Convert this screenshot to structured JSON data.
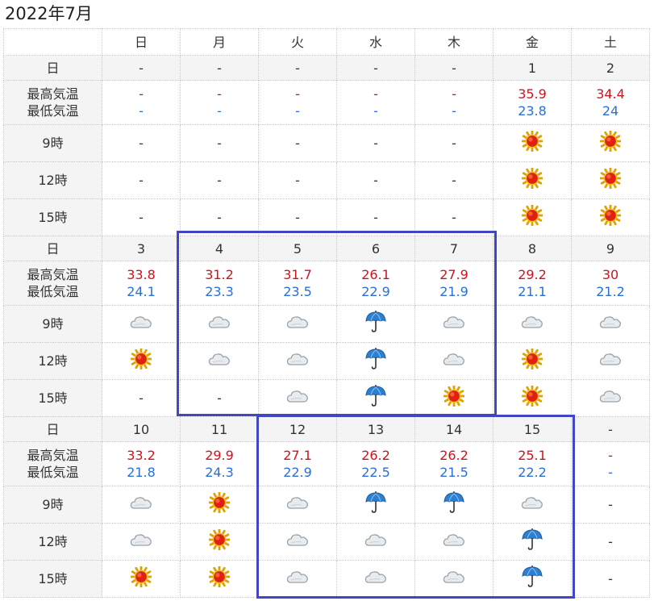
{
  "title": "2022年7月",
  "weekdays": [
    "日",
    "月",
    "火",
    "水",
    "木",
    "金",
    "土"
  ],
  "labels": {
    "date": "日",
    "high": "最高気温",
    "low": "最低気温",
    "h9": "9時",
    "h12": "12時",
    "h15": "15時"
  },
  "colors": {
    "sunday": "#d0121b",
    "saturday": "#2a6fd6",
    "high": "#d0121b",
    "low": "#2a6fd6",
    "highlight": "#4046c4"
  },
  "weeks": [
    {
      "days": [
        {
          "date": "-",
          "high": "-",
          "low": "-",
          "h9": "-",
          "h12": "-",
          "h15": "-"
        },
        {
          "date": "-",
          "high": "-",
          "low": "-",
          "h9": "-",
          "h12": "-",
          "h15": "-"
        },
        {
          "date": "-",
          "high": "-",
          "low": "-",
          "h9": "-",
          "h12": "-",
          "h15": "-"
        },
        {
          "date": "-",
          "high": "-",
          "low": "-",
          "h9": "-",
          "h12": "-",
          "h15": "-"
        },
        {
          "date": "-",
          "high": "-",
          "low": "-",
          "h9": "-",
          "h12": "-",
          "h15": "-"
        },
        {
          "date": "1",
          "high": "35.9",
          "low": "23.8",
          "h9": "sun",
          "h12": "sun",
          "h15": "sun"
        },
        {
          "date": "2",
          "high": "34.4",
          "low": "24",
          "h9": "sun",
          "h12": "sun",
          "h15": "sun"
        }
      ]
    },
    {
      "days": [
        {
          "date": "3",
          "high": "33.8",
          "low": "24.1",
          "h9": "cloud",
          "h12": "sun",
          "h15": "-"
        },
        {
          "date": "4",
          "high": "31.2",
          "low": "23.3",
          "h9": "cloud",
          "h12": "cloud",
          "h15": "-"
        },
        {
          "date": "5",
          "high": "31.7",
          "low": "23.5",
          "h9": "cloud",
          "h12": "cloud",
          "h15": "cloud"
        },
        {
          "date": "6",
          "high": "26.1",
          "low": "22.9",
          "h9": "rain",
          "h12": "rain",
          "h15": "rain"
        },
        {
          "date": "7",
          "high": "27.9",
          "low": "21.9",
          "h9": "cloud",
          "h12": "cloud",
          "h15": "sun"
        },
        {
          "date": "8",
          "high": "29.2",
          "low": "21.1",
          "h9": "cloud",
          "h12": "sun",
          "h15": "sun"
        },
        {
          "date": "9",
          "high": "30",
          "low": "21.2",
          "h9": "cloud",
          "h12": "cloud",
          "h15": "cloud"
        }
      ]
    },
    {
      "days": [
        {
          "date": "10",
          "high": "33.2",
          "low": "21.8",
          "h9": "cloud",
          "h12": "cloud",
          "h15": "sun"
        },
        {
          "date": "11",
          "high": "29.9",
          "low": "24.3",
          "h9": "sun",
          "h12": "sun",
          "h15": "sun"
        },
        {
          "date": "12",
          "high": "27.1",
          "low": "22.9",
          "h9": "cloud",
          "h12": "cloud",
          "h15": "cloud"
        },
        {
          "date": "13",
          "high": "26.2",
          "low": "22.5",
          "h9": "rain",
          "h12": "cloud",
          "h15": "cloud"
        },
        {
          "date": "14",
          "high": "26.2",
          "low": "21.5",
          "h9": "rain",
          "h12": "cloud",
          "h15": "cloud"
        },
        {
          "date": "15",
          "high": "25.1",
          "low": "22.2",
          "h9": "cloud",
          "h12": "rain",
          "h15": "rain"
        },
        {
          "date": "-",
          "high": "-",
          "low": "-",
          "h9": "-",
          "h12": "-",
          "h15": "-"
        }
      ]
    }
  ]
}
